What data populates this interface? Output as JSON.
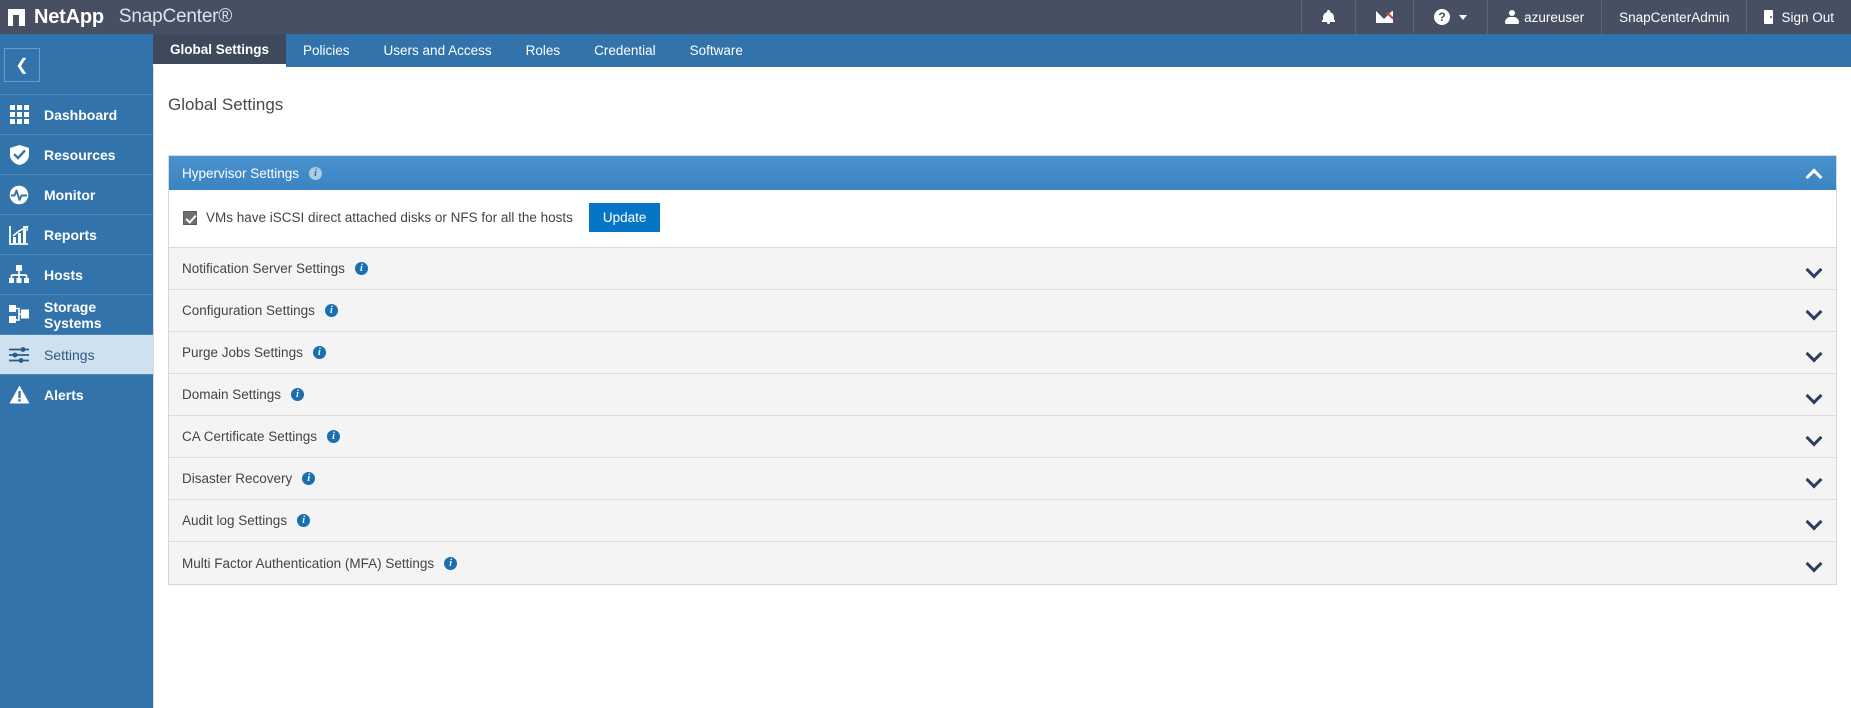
{
  "header": {
    "brand_mark": "netapp-logo-icon",
    "brand_name": "NetApp",
    "product_name": "SnapCenter®",
    "actions": {
      "notifications_icon": "bell-icon",
      "messages_icon": "envelope-icon",
      "help_icon": "question-circle-icon",
      "user_icon": "person-icon",
      "user_name": "azureuser",
      "role": "SnapCenterAdmin",
      "signout_icon": "door-exit-icon",
      "signout_label": "Sign Out"
    }
  },
  "tabs": [
    {
      "label": "Global Settings",
      "active": true
    },
    {
      "label": "Policies",
      "active": false
    },
    {
      "label": "Users and Access",
      "active": false
    },
    {
      "label": "Roles",
      "active": false
    },
    {
      "label": "Credential",
      "active": false
    },
    {
      "label": "Software",
      "active": false
    }
  ],
  "sidebar": {
    "collapse_icon": "chevron-left-icon",
    "items": [
      {
        "label": "Dashboard",
        "icon": "grid-icon",
        "active": false
      },
      {
        "label": "Resources",
        "icon": "shield-check-icon",
        "active": false
      },
      {
        "label": "Monitor",
        "icon": "pulse-circle-icon",
        "active": false
      },
      {
        "label": "Reports",
        "icon": "bar-chart-icon",
        "active": false
      },
      {
        "label": "Hosts",
        "icon": "hosts-tree-icon",
        "active": false
      },
      {
        "label": "Storage Systems",
        "icon": "storage-nodes-icon",
        "active": false
      },
      {
        "label": "Settings",
        "icon": "sliders-icon",
        "active": true
      },
      {
        "label": "Alerts",
        "icon": "warning-triangle-icon",
        "active": false
      }
    ]
  },
  "main": {
    "page_title": "Global Settings",
    "expanded_section": {
      "title": "Hypervisor Settings",
      "info_icon": "info-icon",
      "collapse_icon": "chevron-up-icon",
      "checkbox_checked": true,
      "checkbox_label": "VMs have iSCSI direct attached disks or NFS for all the hosts",
      "update_label": "Update"
    },
    "sections": [
      {
        "title": "Notification Server Settings",
        "info_icon": "info-icon",
        "expand_icon": "chevron-down-icon"
      },
      {
        "title": "Configuration Settings",
        "info_icon": "info-icon",
        "expand_icon": "chevron-down-icon"
      },
      {
        "title": "Purge Jobs Settings",
        "info_icon": "info-icon",
        "expand_icon": "chevron-down-icon"
      },
      {
        "title": "Domain Settings",
        "info_icon": "info-icon",
        "expand_icon": "chevron-down-icon"
      },
      {
        "title": "CA Certificate Settings",
        "info_icon": "info-icon",
        "expand_icon": "chevron-down-icon"
      },
      {
        "title": "Disaster Recovery",
        "info_icon": "info-icon",
        "expand_icon": "chevron-down-icon"
      },
      {
        "title": "Audit log Settings",
        "info_icon": "info-icon",
        "expand_icon": "chevron-down-icon"
      },
      {
        "title": "Multi Factor Authentication (MFA) Settings",
        "info_icon": "info-icon",
        "expand_icon": "chevron-down-icon"
      }
    ]
  },
  "colors": {
    "topbar": "#474f63",
    "tabbar": "#3273ab",
    "sidebar": "#3273ab",
    "sidebar_active": "#cfe0ef",
    "panel_header": "#3a84c3",
    "accent_button": "#0675c5",
    "row_background": "#f4f4f4"
  }
}
